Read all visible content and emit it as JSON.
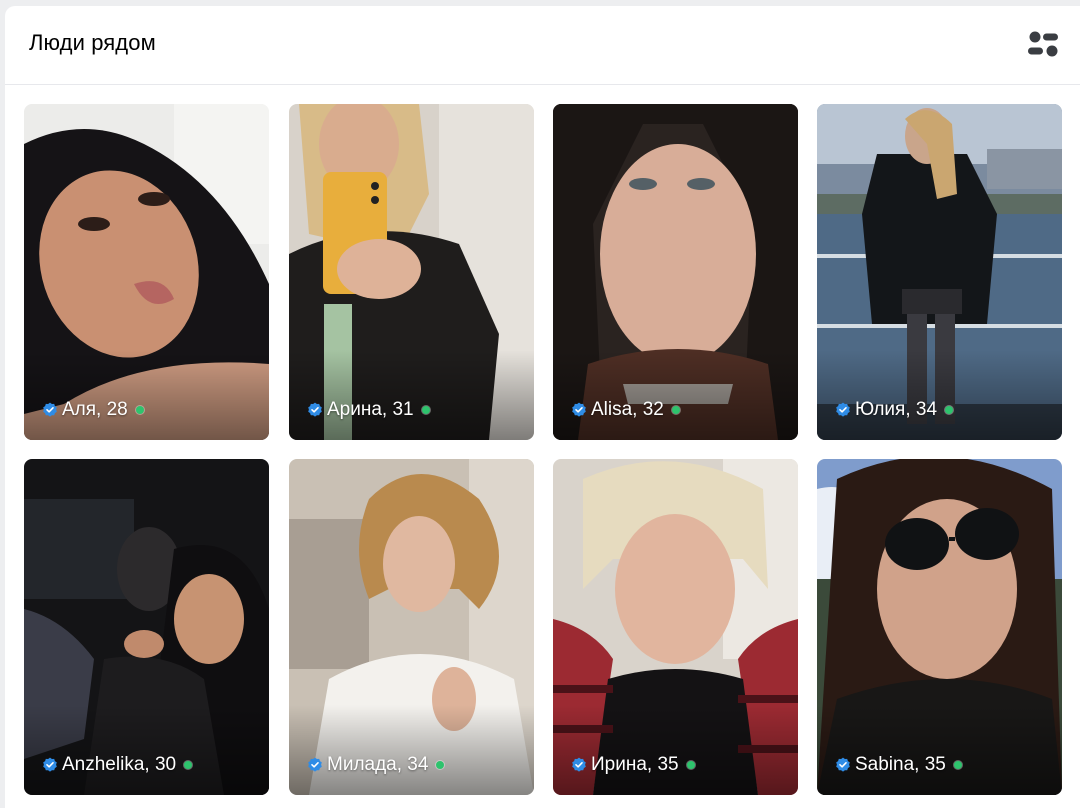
{
  "header": {
    "title": "Люди рядом",
    "filter_icon": "filter-toggle-icon"
  },
  "colors": {
    "online": "#2ec36d",
    "verified": "#2f8ce6"
  },
  "people": [
    {
      "caption": "Аля, 28",
      "verified": true,
      "online": true
    },
    {
      "caption": "Арина, 31",
      "verified": true,
      "online": true
    },
    {
      "caption": "Alisa, 32",
      "verified": true,
      "online": true
    },
    {
      "caption": "Юлия, 34",
      "verified": true,
      "online": true
    },
    {
      "caption": "Anzhelika, 30",
      "verified": true,
      "online": true
    },
    {
      "caption": "Милада, 34",
      "verified": true,
      "online": true
    },
    {
      "caption": "Ирина, 35",
      "verified": true,
      "online": true
    },
    {
      "caption": "Sabina, 35",
      "verified": true,
      "online": true
    }
  ]
}
